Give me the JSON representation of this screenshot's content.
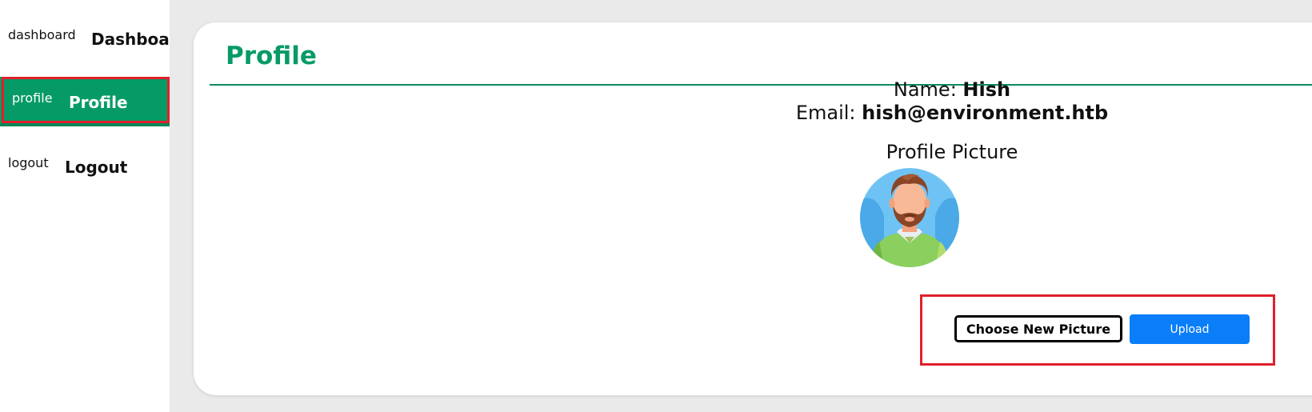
{
  "sidebar": {
    "items": [
      {
        "icon_alt": "dashboard",
        "label": "Dashboard"
      },
      {
        "icon_alt": "profile",
        "label": "Profile",
        "active": true
      },
      {
        "icon_alt": "logout",
        "label": "Logout"
      }
    ],
    "active_color": "#069b66"
  },
  "main": {
    "title": "Profile",
    "name_label": "Name:",
    "name_value": "Hish",
    "email_label": "Email:",
    "email_value": "hish@environment.htb",
    "picture_label": "Profile Picture",
    "avatar_icon": "bearded-man-avatar",
    "choose_label": "Choose New Picture",
    "upload_label": "Upload"
  },
  "colors": {
    "accent": "#069b66",
    "upload_button": "#0a7ef8",
    "highlight": "#e0202a"
  }
}
